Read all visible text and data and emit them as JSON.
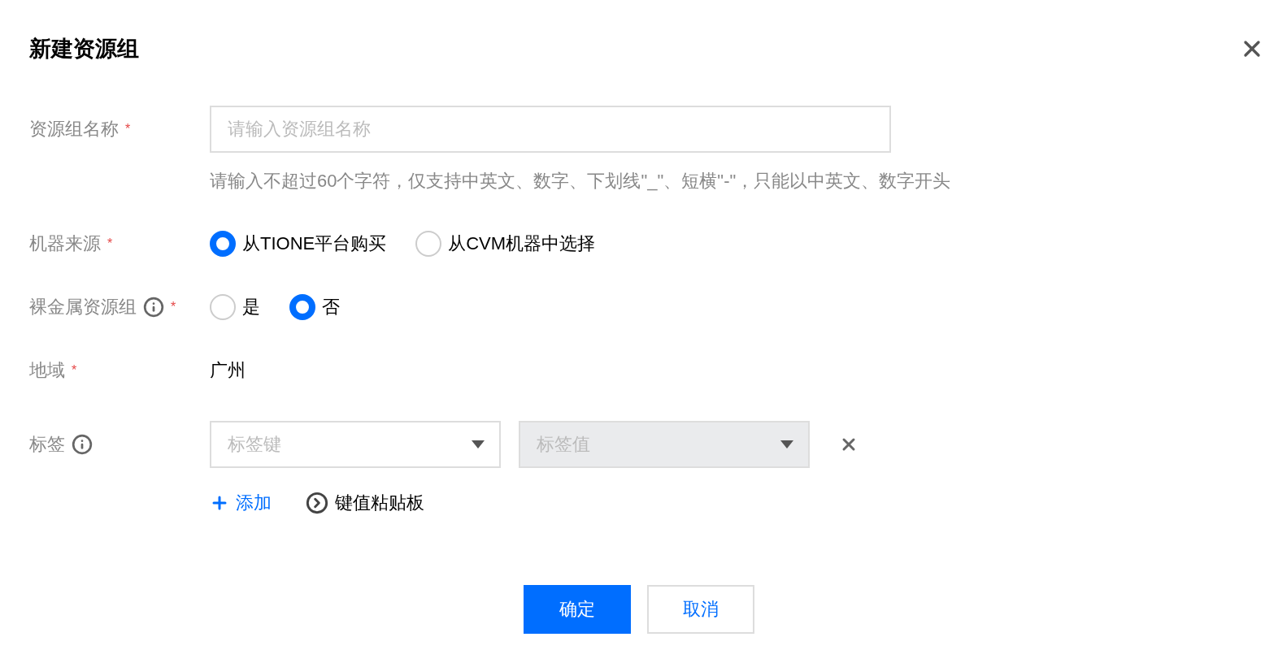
{
  "dialog": {
    "title": "新建资源组"
  },
  "fields": [
    {
      "kind": "input",
      "label": "资源组名称",
      "required_mark": "*",
      "info": false,
      "placeholder": "请输入资源组名称",
      "hint": "请输入不超过60个字符，仅支持中英文、数字、下划线\"_\"、短横\"-\"，只能以中英文、数字开头"
    },
    {
      "kind": "radio",
      "label": "机器来源",
      "required_mark": "*",
      "info": false,
      "options": [
        {
          "label": "从TIONE平台购买",
          "selected": true
        },
        {
          "label": "从CVM机器中选择",
          "selected": false
        }
      ]
    },
    {
      "kind": "radio",
      "label": "裸金属资源组",
      "required_mark": "*",
      "info": true,
      "options": [
        {
          "label": "是",
          "selected": false
        },
        {
          "label": "否",
          "selected": true
        }
      ]
    },
    {
      "kind": "text",
      "label": "地域",
      "required_mark": "*",
      "info": false,
      "value": "广州"
    },
    {
      "kind": "tags",
      "label": "标签",
      "info": true,
      "tags": [
        {
          "key_placeholder": "标签键",
          "value_placeholder": "标签值",
          "value_disabled": true
        }
      ],
      "actions": [
        {
          "kind": "add",
          "label": "添加"
        },
        {
          "kind": "paste",
          "label": "键值粘贴板"
        }
      ]
    }
  ],
  "buttons": [
    {
      "label": "确定",
      "primary": true
    },
    {
      "label": "取消",
      "primary": false
    }
  ]
}
